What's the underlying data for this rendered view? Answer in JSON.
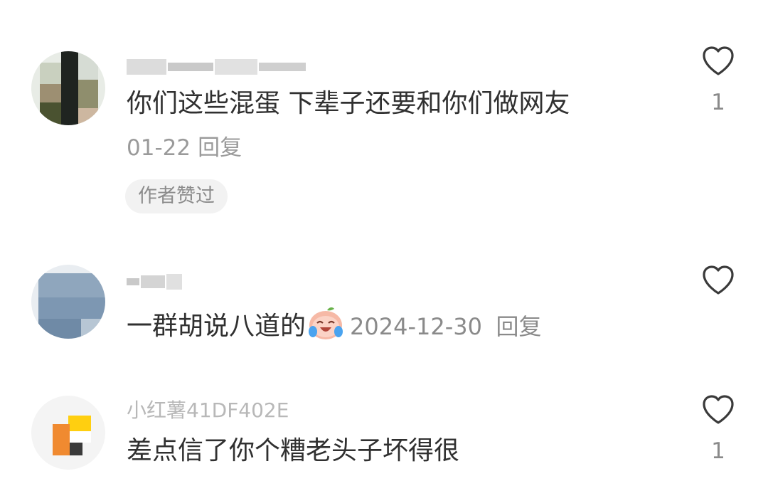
{
  "comments": [
    {
      "username": "",
      "text": "你们这些混蛋 下辈子还要和你们做网友",
      "date": "01-22",
      "reply_label": "回复",
      "badge": "作者赞过",
      "like_count": "1"
    },
    {
      "username": "",
      "text": "一群胡说八道的",
      "emoji_icon": "laughing-crying-emoji-icon",
      "date": "2024-12-30",
      "reply_label": "回复",
      "like_count": ""
    },
    {
      "username": "小红薯41DF402E",
      "text": "差点信了你个糟老头子坏得很",
      "like_count": "1"
    }
  ],
  "icons": {
    "like": "heart-outline-icon"
  },
  "colors": {
    "text": "#303030",
    "meta": "#9a9a9a",
    "badge_bg": "#f2f2f2"
  }
}
